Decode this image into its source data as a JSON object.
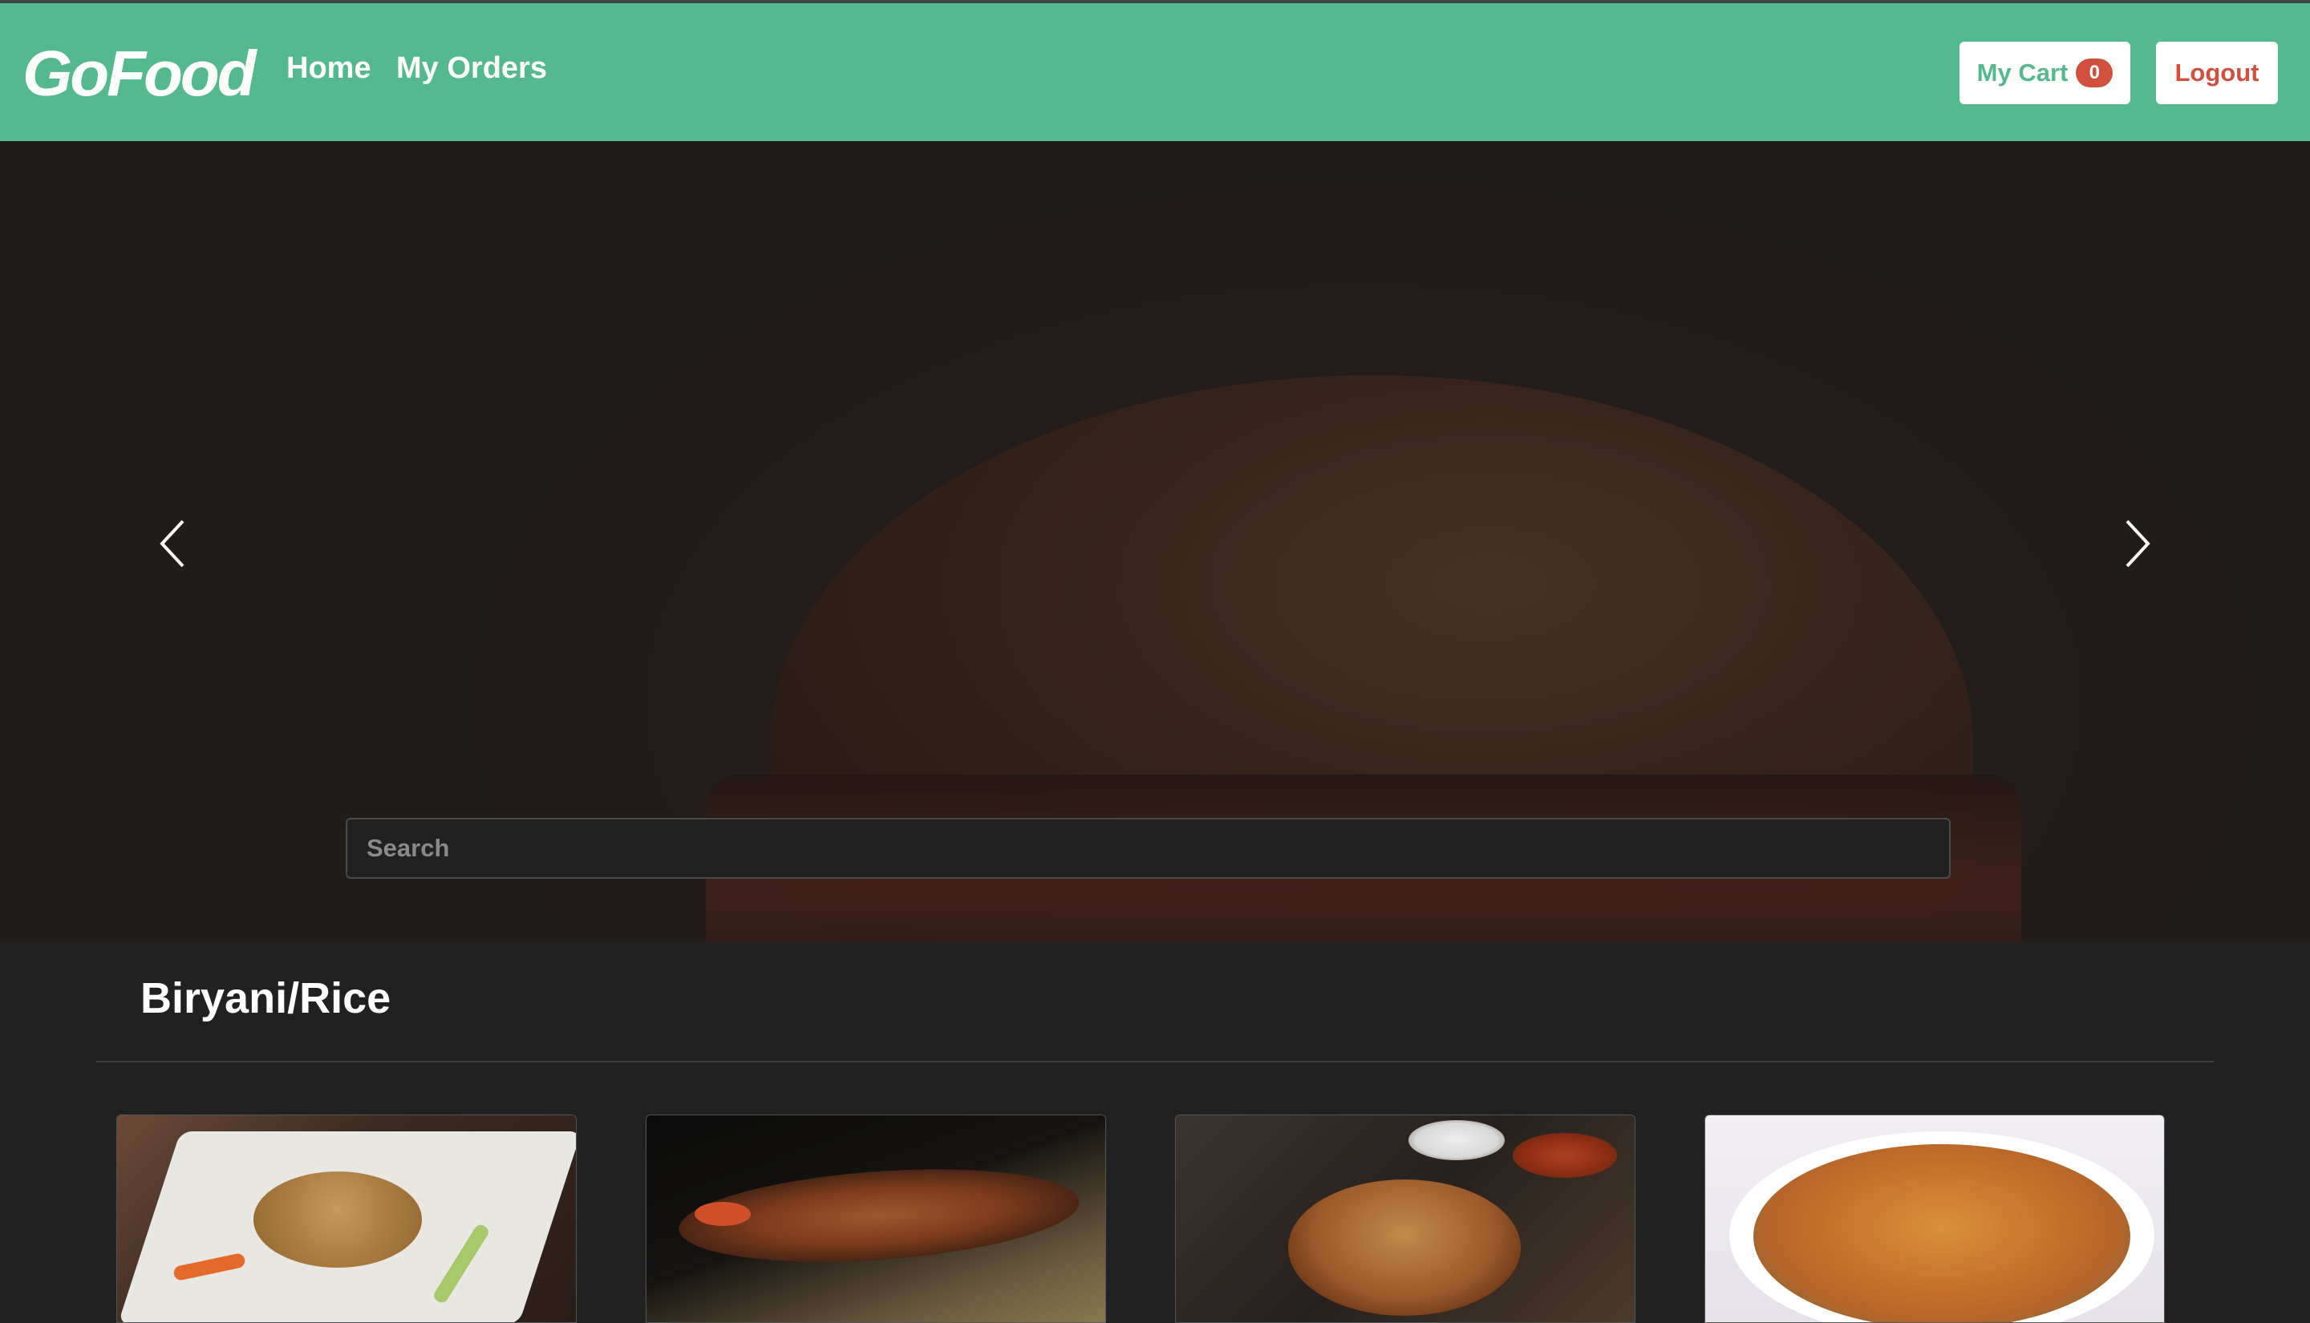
{
  "navbar": {
    "brand": "GoFood",
    "links": [
      "Home",
      "My Orders"
    ],
    "cart_label": "My Cart",
    "cart_count": "0",
    "logout_label": "Logout",
    "colors": {
      "navbar_bg": "#55b98f",
      "cart_text": "#55b98f",
      "logout_text": "#d04f3d",
      "badge_bg": "#d04f3d"
    }
  },
  "hero": {
    "search_placeholder": "Search",
    "prev_icon": "chevron-left-icon",
    "next_icon": "chevron-right-icon"
  },
  "category": {
    "title": "Biryani/Rice",
    "items": [
      {
        "image": "fried-rice-plate"
      },
      {
        "image": "platter-dark-background"
      },
      {
        "image": "biryani-bowl"
      },
      {
        "image": "biryani-white-plate"
      }
    ]
  },
  "theme": {
    "page_bg": "#212121"
  }
}
